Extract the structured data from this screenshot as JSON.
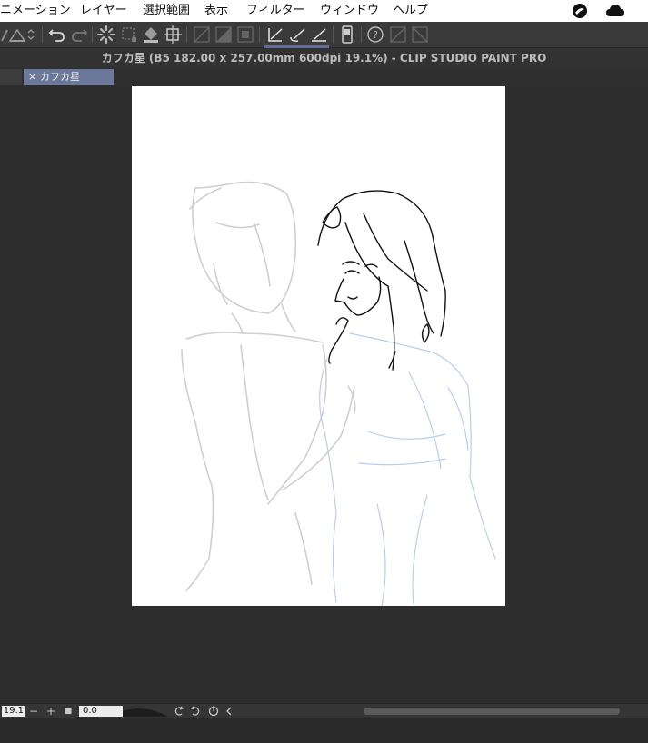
{
  "menu": {
    "items": [
      "ニメーション",
      "レイヤー",
      "選択範囲",
      "表示",
      "フィルター",
      "ウィンドウ",
      "ヘルプ"
    ]
  },
  "toolbar": {
    "icons": [
      "pen-icon",
      "ruler-icon",
      "undo-icon",
      "redo-icon",
      "loading-icon",
      "transform-icon",
      "fill-icon",
      "crop-icon",
      "snap-off-icon",
      "snap-grid-icon",
      "snap-frame-icon",
      "snap-ruler-icon",
      "snap-curve-icon",
      "snap-line-icon",
      "tablet-icon",
      "help-icon",
      "snap-extra-icon"
    ]
  },
  "window": {
    "title": "カフカ星 (B5 182.00 x 257.00mm 600dpi 19.1%)  - CLIP STUDIO PAINT PRO"
  },
  "tabs": [
    {
      "close": "×",
      "label": "カフカ星",
      "active": true
    }
  ],
  "status": {
    "zoom_value": "19.1",
    "zoom_out": "−",
    "zoom_in": "+",
    "fit": "■",
    "angle_value": "0.0"
  },
  "colors": {
    "active_tool_bg": "#5e6f95",
    "tab_active_bg": "#6b7899",
    "sketch_gray": "#cfcfcf",
    "sketch_blue": "#b8cfe8",
    "line_black": "#111111"
  }
}
